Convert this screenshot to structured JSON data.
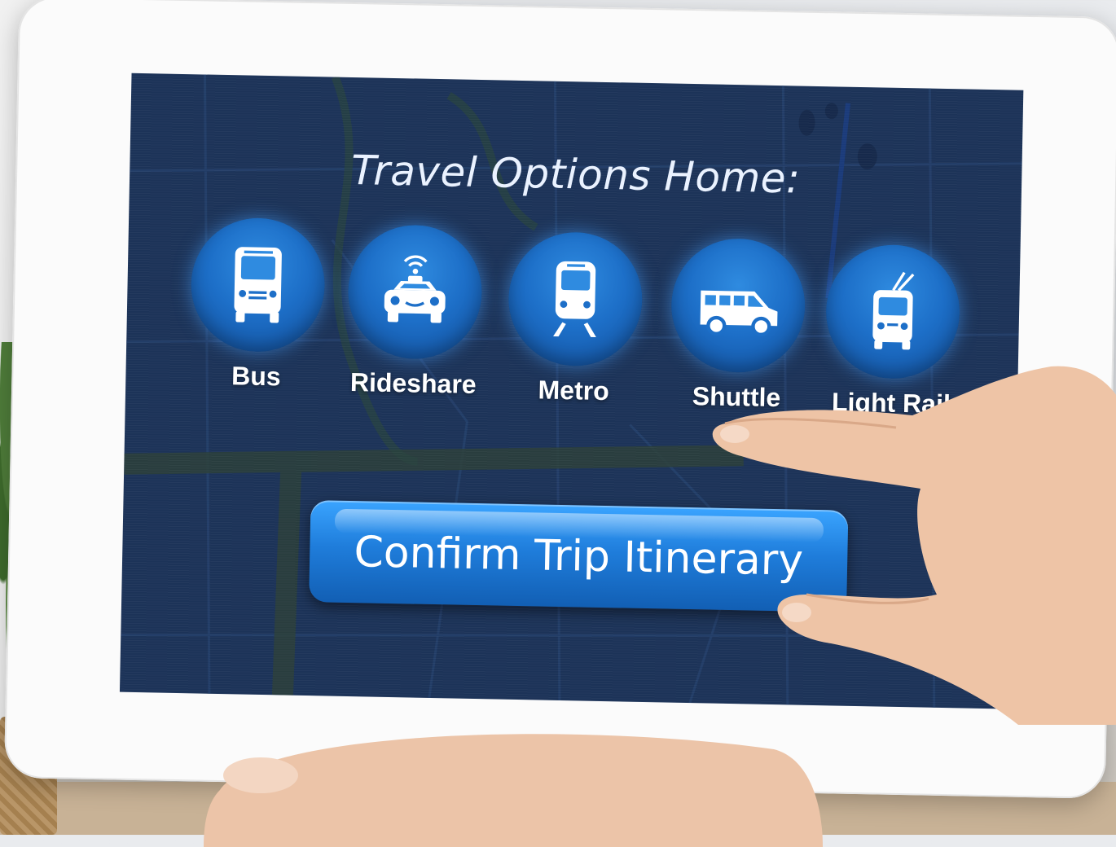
{
  "screen": {
    "title": "Travel Options Home:",
    "options": [
      {
        "id": "bus",
        "label": "Bus",
        "icon": "bus-icon"
      },
      {
        "id": "rideshare",
        "label": "Rideshare",
        "icon": "car-icon"
      },
      {
        "id": "metro",
        "label": "Metro",
        "icon": "train-icon"
      },
      {
        "id": "shuttle",
        "label": "Shuttle",
        "icon": "van-icon"
      },
      {
        "id": "lightrail",
        "label": "Light Rail",
        "icon": "trolley-icon"
      }
    ],
    "confirm_label": "Confirm Trip Itinerary"
  },
  "colors": {
    "screen_bg": "#1c3358",
    "button_blue": "#1f7ddb",
    "icon_circle": "#1d6fc8",
    "text": "#ffffff"
  }
}
